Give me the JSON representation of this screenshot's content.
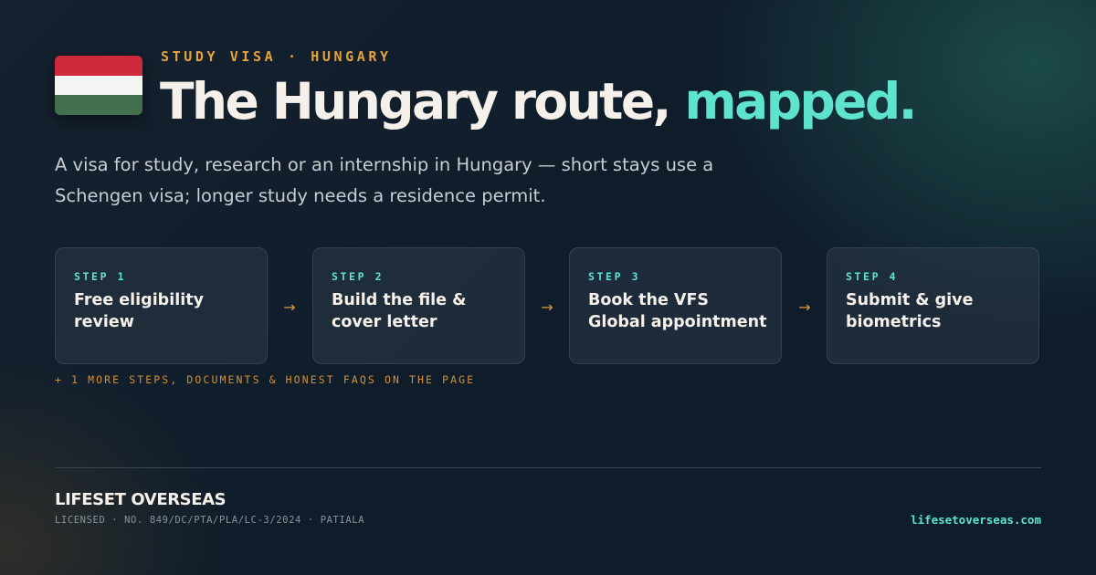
{
  "colors": {
    "accent_teal": "#5ee3cf",
    "accent_amber": "#e5a43b",
    "background": "#0f1c2a",
    "flag_red": "#cd2a3e",
    "flag_white": "#f4f4f2",
    "flag_green": "#436f4d"
  },
  "hero": {
    "flag_icon": "hungary-flag-icon",
    "eyebrow": "STUDY VISA · HUNGARY",
    "headline_main": "The Hungary route, ",
    "headline_accent": "mapped.",
    "lede": "A visa for study, research or an internship in Hungary — short stays use a Schengen visa; longer study needs a residence permit."
  },
  "steps": [
    {
      "label": "STEP 1",
      "title": "Free eligibility review"
    },
    {
      "label": "STEP 2",
      "title": "Build the file & cover letter"
    },
    {
      "label": "STEP 3",
      "title": "Book the VFS Global appointment"
    },
    {
      "label": "STEP 4",
      "title": "Submit & give biometrics"
    }
  ],
  "arrow_glyph": "→",
  "more_note": "+ 1 MORE STEPS, DOCUMENTS & HONEST FAQS ON THE PAGE",
  "footer": {
    "brand": "LIFESET OVERSEAS",
    "license": "LICENSED · NO. 849/DC/PTA/PLA/LC-3/2024 · PATIALA",
    "site": "lifesetoverseas.com"
  }
}
